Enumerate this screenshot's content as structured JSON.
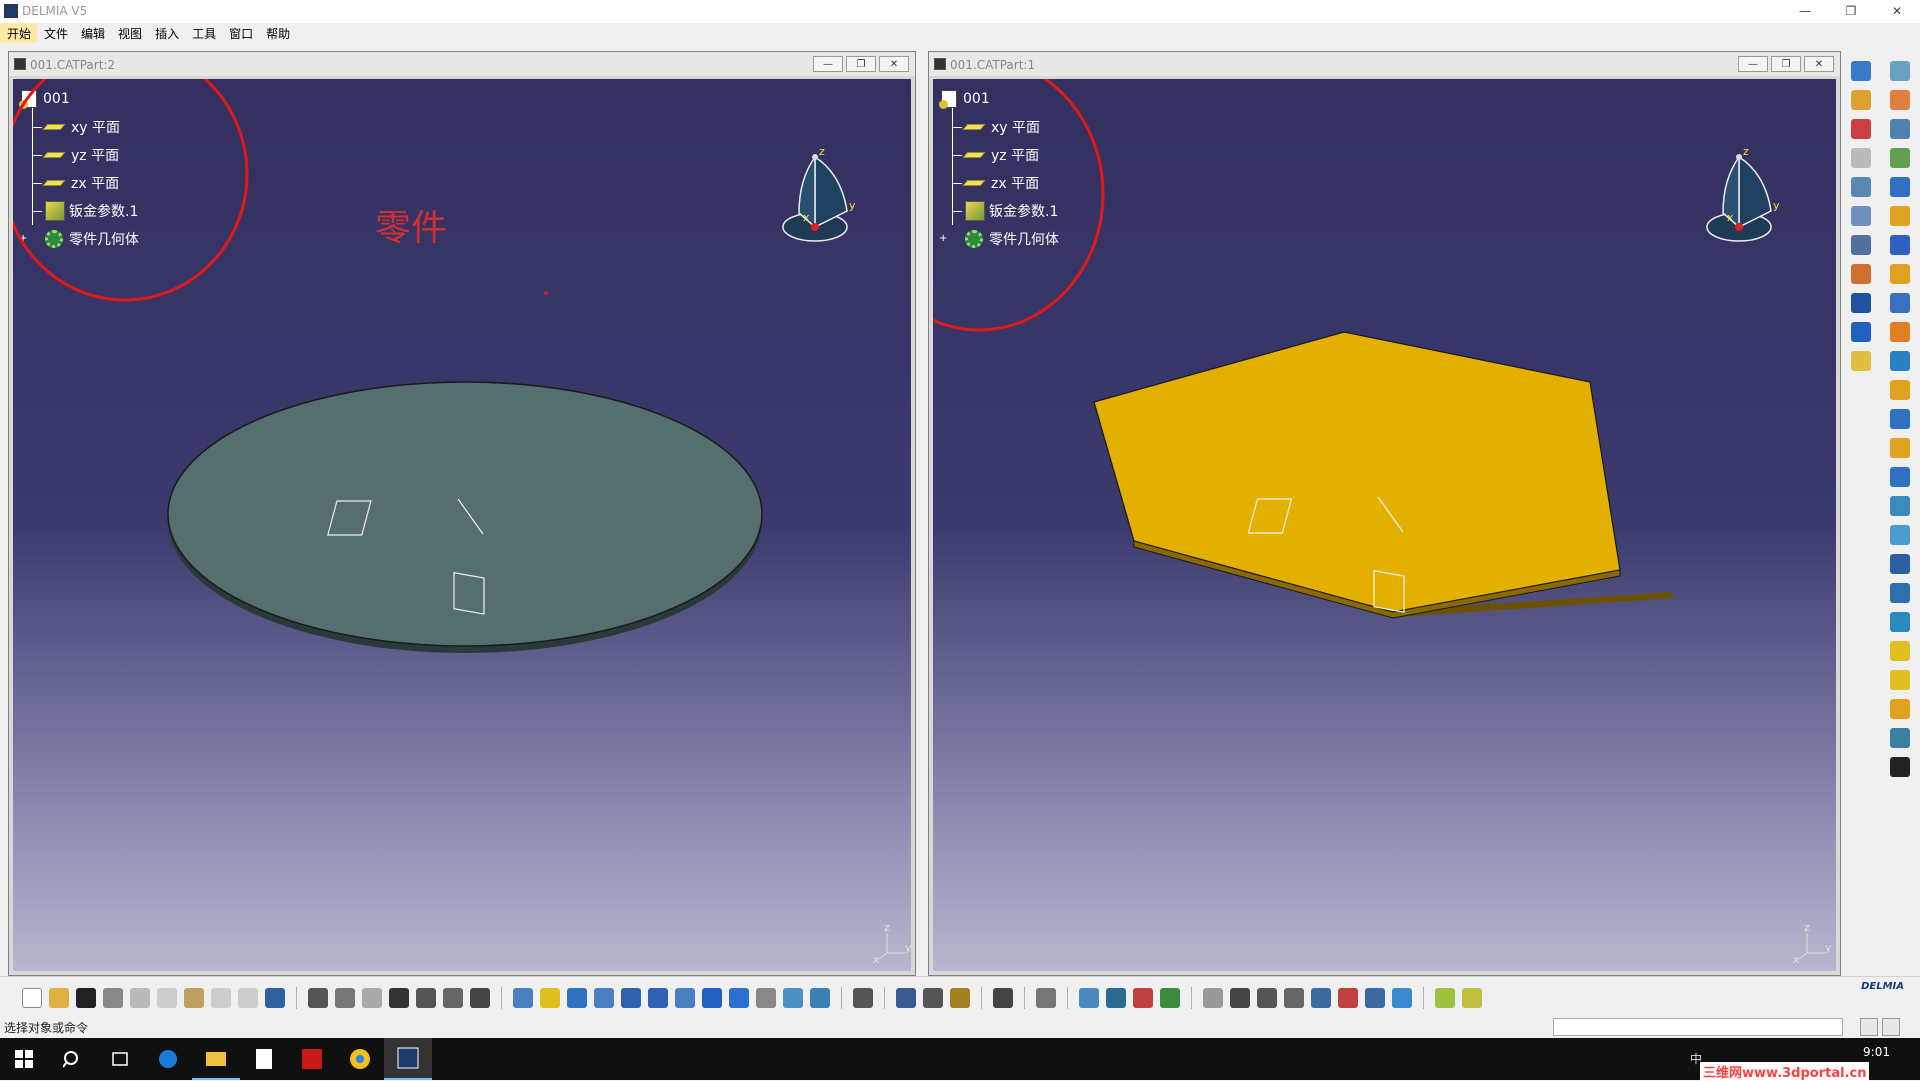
{
  "app": {
    "title": "DELMIA V5"
  },
  "window_controls": {
    "minimize": "—",
    "restore": "❐",
    "close": "✕"
  },
  "menu": [
    "开始",
    "文件",
    "编辑",
    "视图",
    "插入",
    "工具",
    "窗口",
    "帮助"
  ],
  "windows": [
    {
      "title": "001.CATPart:2",
      "tree": {
        "root": "001",
        "items": [
          "xy 平面",
          "yz 平面",
          "zx 平面",
          "钣金参数.1",
          "零件几何体"
        ]
      },
      "annotation": "零件",
      "shape": "ellipse",
      "shape_color": "#556e6e"
    },
    {
      "title": "001.CATPart:1",
      "tree": {
        "root": "001",
        "items": [
          "xy 平面",
          "yz 平面",
          "zx 平面",
          "钣金参数.1",
          "零件几何体"
        ]
      },
      "shape": "hexagon",
      "shape_color": "#e3b000"
    }
  ],
  "compass_labels": {
    "x": "x",
    "y": "y",
    "z": "z"
  },
  "status": {
    "message": "选择对象或命令"
  },
  "brand": "DELMIA",
  "taskbar": {
    "time": "9:01",
    "watermark": "三维网www.3dportal.cn",
    "tray": "中"
  }
}
